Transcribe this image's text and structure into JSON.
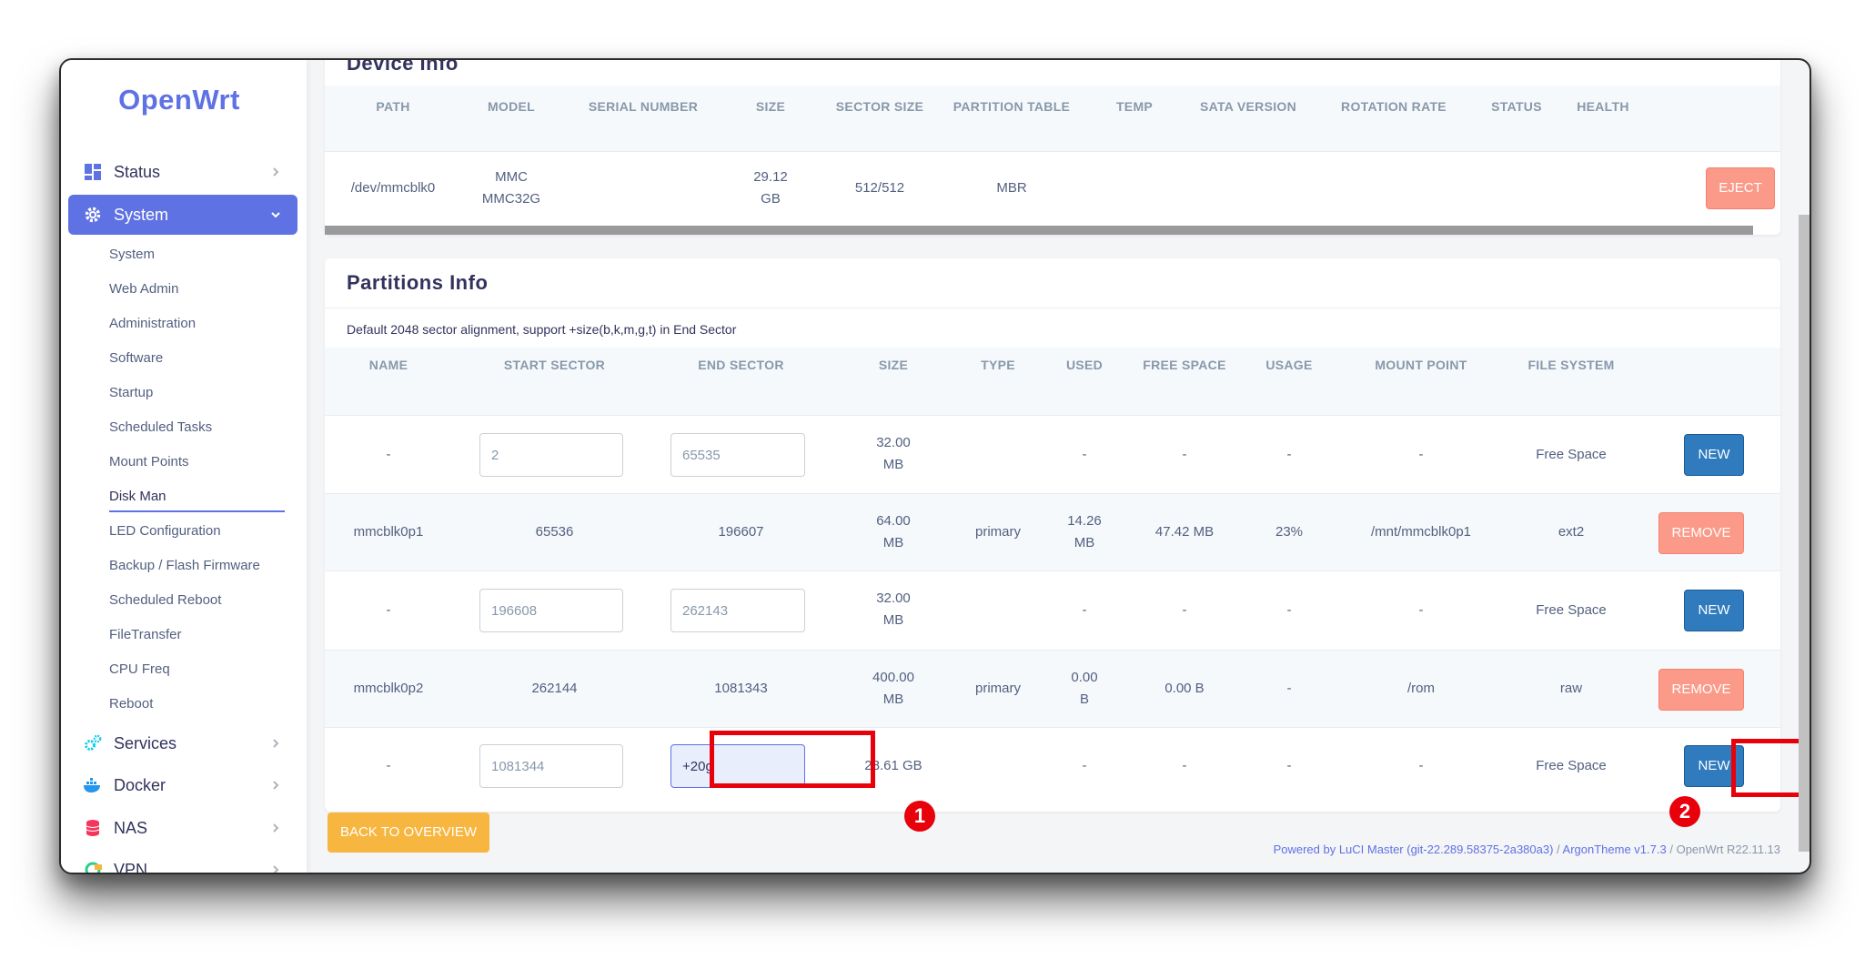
{
  "brand": "OpenWrt",
  "sidebar": {
    "top_items": [
      {
        "label": "Status",
        "icon": "dashboard-icon"
      },
      {
        "label": "System",
        "icon": "gear-icon"
      }
    ],
    "sub_items": [
      "System",
      "Web Admin",
      "Administration",
      "Software",
      "Startup",
      "Scheduled Tasks",
      "Mount Points",
      "Disk Man",
      "LED Configuration",
      "Backup / Flash Firmware",
      "Scheduled Reboot",
      "FileTransfer",
      "CPU Freq",
      "Reboot"
    ],
    "bottom_items": [
      {
        "label": "Services",
        "icon": "cogs-icon"
      },
      {
        "label": "Docker",
        "icon": "docker-icon"
      },
      {
        "label": "NAS",
        "icon": "database-icon"
      },
      {
        "label": "VPN",
        "icon": "vpn-icon"
      }
    ]
  },
  "device_info": {
    "title": "Device Info",
    "headers": [
      "PATH",
      "MODEL",
      "SERIAL NUMBER",
      "SIZE",
      "SECTOR SIZE",
      "PARTITION TABLE",
      "TEMP",
      "SATA VERSION",
      "ROTATION RATE",
      "STATUS",
      "HEALTH"
    ],
    "row": {
      "path": "/dev/mmcblk0",
      "model_1": "MMC",
      "model_2": "MMC32G",
      "size_1": "29.12",
      "size_2": "GB",
      "sector_size": "512/512",
      "partition_table": "MBR"
    },
    "eject_label": "EJECT"
  },
  "partitions": {
    "title": "Partitions Info",
    "note": "Default 2048 sector alignment, support +size(b,k,m,g,t) in End Sector",
    "headers": [
      "NAME",
      "START SECTOR",
      "END SECTOR",
      "SIZE",
      "TYPE",
      "USED",
      "FREE SPACE",
      "USAGE",
      "MOUNT POINT",
      "FILE SYSTEM"
    ],
    "rows": [
      {
        "name": "-",
        "start": "2",
        "end": "65535",
        "size_1": "32.00",
        "size_2": "MB",
        "type": "",
        "used_1": "-",
        "used_2": "",
        "free": "-",
        "usage": "-",
        "mount": "-",
        "fs": "Free Space",
        "action": "NEW"
      },
      {
        "name": "mmcblk0p1",
        "start": "65536",
        "end": "196607",
        "size_1": "64.00",
        "size_2": "MB",
        "type": "primary",
        "used_1": "14.26",
        "used_2": "MB",
        "free": "47.42 MB",
        "usage": "23%",
        "mount": "/mnt/mmcblk0p1",
        "fs": "ext2",
        "action": "REMOVE"
      },
      {
        "name": "-",
        "start": "196608",
        "end": "262143",
        "size_1": "32.00",
        "size_2": "MB",
        "type": "",
        "used_1": "-",
        "used_2": "",
        "free": "-",
        "usage": "-",
        "mount": "-",
        "fs": "Free Space",
        "action": "NEW"
      },
      {
        "name": "mmcblk0p2",
        "start": "262144",
        "end": "1081343",
        "size_1": "400.00",
        "size_2": "MB",
        "type": "primary",
        "used_1": "0.00",
        "used_2": "B",
        "free": "0.00 B",
        "usage": "-",
        "mount": "/rom",
        "fs": "raw",
        "action": "REMOVE"
      },
      {
        "name": "-",
        "start": "1081344",
        "end": "+20g",
        "size_1": "28.61 GB",
        "size_2": "",
        "type": "",
        "used_1": "-",
        "used_2": "",
        "free": "-",
        "usage": "-",
        "mount": "-",
        "fs": "Free Space",
        "action": "NEW"
      }
    ]
  },
  "back_label": "BACK TO OVERVIEW",
  "annotations": {
    "one": "1",
    "two": "2"
  },
  "footer": {
    "luci": "Powered by LuCI Master (git-22.289.58375-2a380a3)",
    "sep1": " / ",
    "theme": "ArgonTheme v1.7.3",
    "sep2": " / ",
    "os": "OpenWrt R22.11.13"
  },
  "colors": {
    "accent": "#5e72e4",
    "new_button": "#2f7bbd",
    "remove_button": "#fb9a88",
    "back_button": "#f7b63f",
    "highlight": "#e8000b"
  }
}
